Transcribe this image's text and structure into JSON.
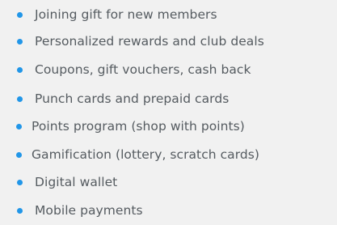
{
  "features": {
    "bullet_color": "#2196e8",
    "text_color": "#555b60",
    "background_color": "#f1f1f1",
    "items": [
      {
        "icon": "bullet-dot",
        "label": "Joining gift for new members"
      },
      {
        "icon": "bullet-dot",
        "label": "Personalized rewards and club deals"
      },
      {
        "icon": "bullet-dot",
        "label": "Coupons, gift vouchers, cash back"
      },
      {
        "icon": "bullet-dot",
        "label": "Punch cards and prepaid cards"
      },
      {
        "icon": "bullet-dot",
        "label": "Points program (shop with points)"
      },
      {
        "icon": "bullet-dot",
        "label": "Gamification (lottery, scratch cards)"
      },
      {
        "icon": "bullet-dot",
        "label": "Digital wallet"
      },
      {
        "icon": "bullet-dot",
        "label": "Mobile payments"
      }
    ]
  }
}
